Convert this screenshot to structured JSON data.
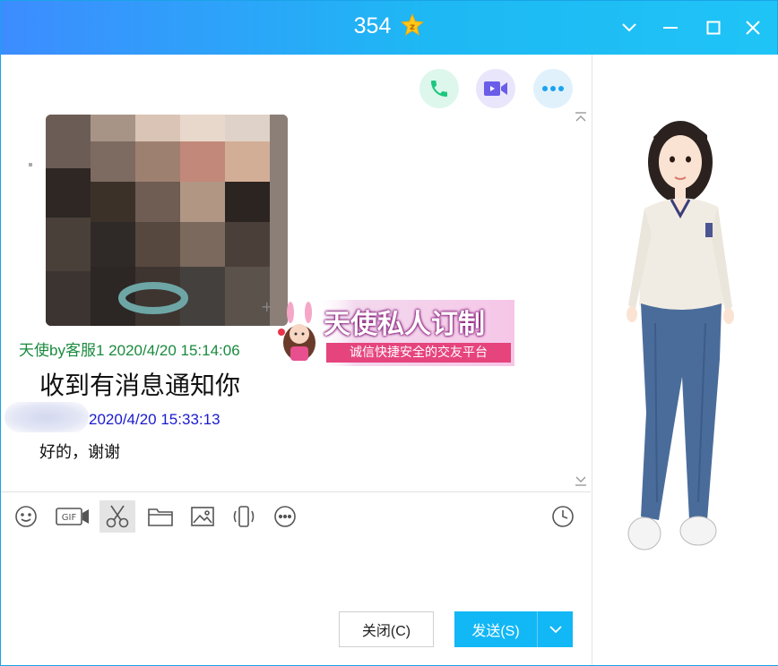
{
  "window": {
    "title": "354",
    "accent_color": "#12b7f5",
    "title_icon": "zzz-star-icon"
  },
  "header_actions": [
    {
      "icon": "phone-icon",
      "color": "#1cc77e"
    },
    {
      "icon": "video-icon",
      "color": "#6a5de8"
    },
    {
      "icon": "more-icon",
      "color": "#1ba3f0"
    }
  ],
  "messages": [
    {
      "sender": "天使by客服1",
      "time": "2020/4/20 15:14:06",
      "text": "收到有消息通知你"
    },
    {
      "sender": "",
      "time": "2020/4/20 15:33:13",
      "text": "好的，谢谢"
    }
  ],
  "ad_banner": {
    "title": "天使私人订制",
    "subtitle": "诚信快捷安全的交友平台"
  },
  "toolbar": [
    {
      "name": "emoji-icon"
    },
    {
      "name": "gif-icon",
      "label": "GIF"
    },
    {
      "name": "scissors-icon"
    },
    {
      "name": "folder-icon"
    },
    {
      "name": "image-icon"
    },
    {
      "name": "shake-icon"
    },
    {
      "name": "more-tools-icon"
    },
    {
      "name": "history-icon"
    }
  ],
  "buttons": {
    "close_label": "关闭(C)",
    "send_label": "发送(S)"
  }
}
